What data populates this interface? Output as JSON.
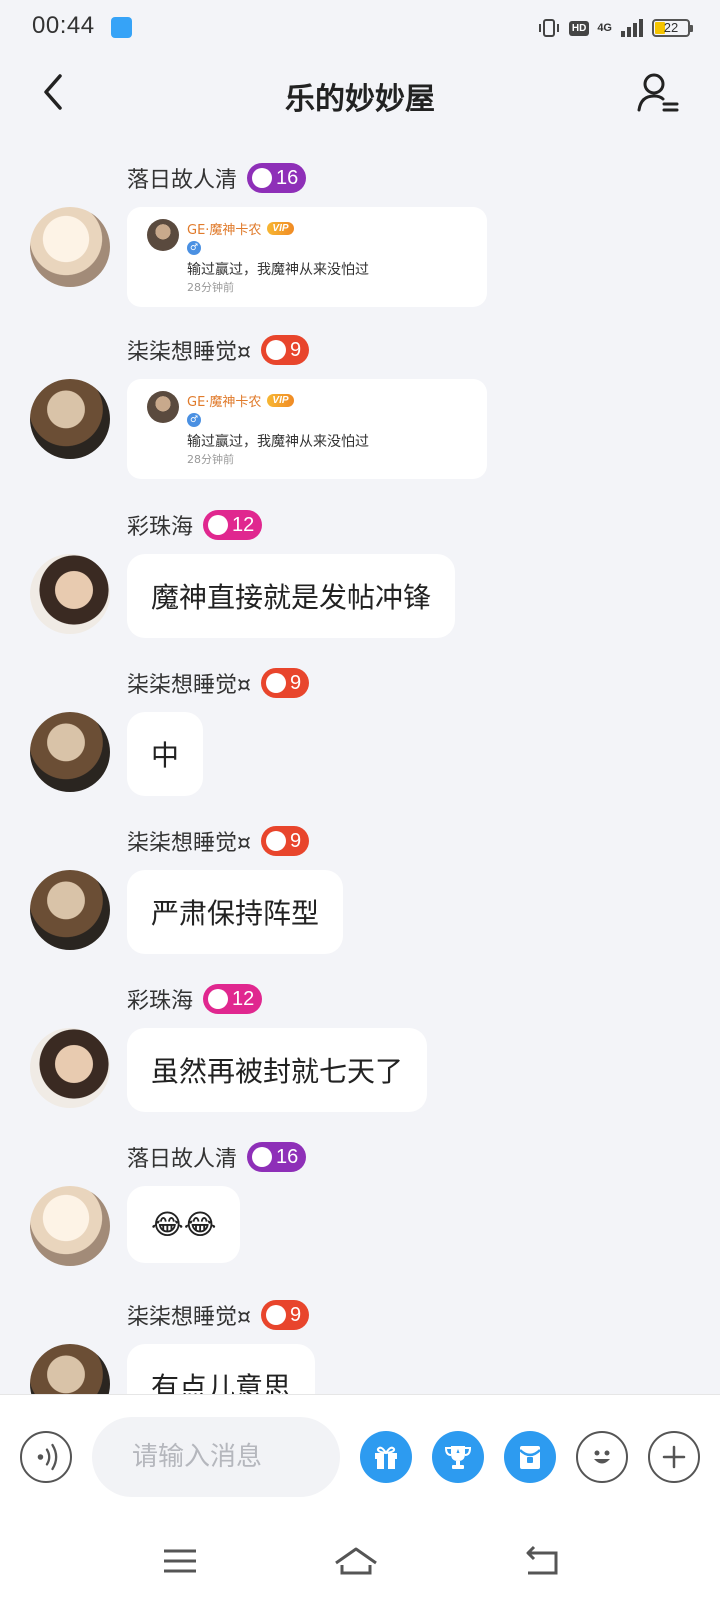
{
  "status_bar": {
    "time": "00:44",
    "hd_label": "HD",
    "network_label": "4G",
    "battery_level": "22"
  },
  "header": {
    "title": "乐的妙妙屋"
  },
  "messages": [
    {
      "type": "card",
      "sender": "落日故人清",
      "level": "16",
      "badge_color": "#8e2fb8",
      "card": {
        "author": "GE·魔神卡农",
        "vip_label": "VIP",
        "text": "输过赢过，我魔神从来没怕过",
        "time": "28分钟前"
      }
    },
    {
      "type": "card",
      "sender": "柒柒想睡觉¤",
      "level": "9",
      "badge_color": "#e8452c",
      "card": {
        "author": "GE·魔神卡农",
        "vip_label": "VIP",
        "text": "输过赢过，我魔神从来没怕过",
        "time": "28分钟前"
      }
    },
    {
      "type": "text",
      "sender": "彩珠海",
      "level": "12",
      "badge_color": "#e0278f",
      "text": "魔神直接就是发帖冲锋"
    },
    {
      "type": "text",
      "sender": "柒柒想睡觉¤",
      "level": "9",
      "badge_color": "#e8452c",
      "text": "中"
    },
    {
      "type": "text",
      "sender": "柒柒想睡觉¤",
      "level": "9",
      "badge_color": "#e8452c",
      "text": "严肃保持阵型"
    },
    {
      "type": "text",
      "sender": "彩珠海",
      "level": "12",
      "badge_color": "#e0278f",
      "text": "虽然再被封就七天了"
    },
    {
      "type": "text",
      "sender": "落日故人清",
      "level": "16",
      "badge_color": "#8e2fb8",
      "text": "😂😂"
    },
    {
      "type": "text",
      "sender": "柒柒想睡觉¤",
      "level": "9",
      "badge_color": "#e8452c",
      "text": "有点儿意思"
    }
  ],
  "input": {
    "placeholder": "请输入消息"
  },
  "colors": {
    "accent": "#2d9bf0",
    "background": "#f3f4f8"
  },
  "icons": [
    "back-icon",
    "members-icon",
    "voice-icon",
    "gift-icon",
    "trophy-icon",
    "red-packet-icon",
    "emoji-icon",
    "plus-icon",
    "menu-icon",
    "home-icon",
    "return-icon"
  ]
}
